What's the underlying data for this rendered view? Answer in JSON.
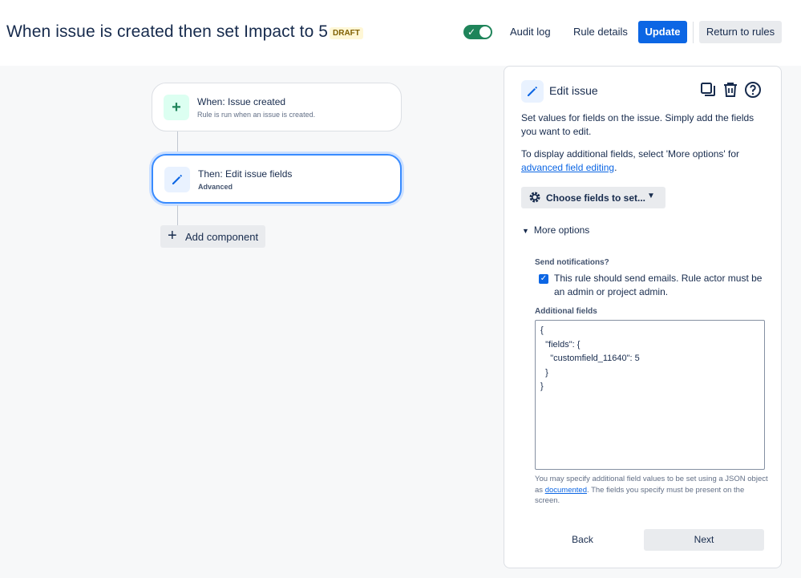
{
  "header": {
    "title": "When issue is created then set Impact to 5",
    "badge": "DRAFT",
    "toggle_state": "on",
    "audit_log": "Audit log",
    "rule_details": "Rule details",
    "update": "Update",
    "return_to_rules": "Return to rules"
  },
  "flow": {
    "trigger": {
      "title": "When: Issue created",
      "subtitle": "Rule is run when an issue is created.",
      "icon": "plus-icon"
    },
    "action": {
      "title": "Then: Edit issue fields",
      "subtitle": "Advanced",
      "icon": "pencil-icon"
    },
    "add_component": "Add component"
  },
  "panel": {
    "title": "Edit issue",
    "icons": [
      "pencil-icon",
      "copy-icon",
      "trash-icon",
      "help-icon"
    ],
    "description": "Set values for fields on the issue. Simply add the fields you want to edit.",
    "additional_prefix": "To display additional fields, select 'More options' for",
    "additional_link": "advanced field editing",
    "additional_suffix": ".",
    "choose_fields": "Choose fields to set...",
    "more_options": "More options",
    "send_notifications_label": "Send notifications?",
    "send_notifications_checked": true,
    "send_notifications_text": "This rule should send emails. Rule actor must be an admin or project admin.",
    "additional_fields_label": "Additional fields",
    "additional_fields_value": "{\n  \"fields\": {\n    \"customfield_11640\": 5\n  }\n}",
    "help_prefix": "You may specify additional field values to be set using a JSON object as",
    "help_link": "documented",
    "help_suffix": ". The fields you specify must be present on the screen.",
    "back": "Back",
    "next": "Next"
  },
  "colors": {
    "primary": "#0c66e4",
    "toggle_on": "#1f845a",
    "draft_bg": "#fff7d6",
    "draft_text": "#7f5f01"
  }
}
